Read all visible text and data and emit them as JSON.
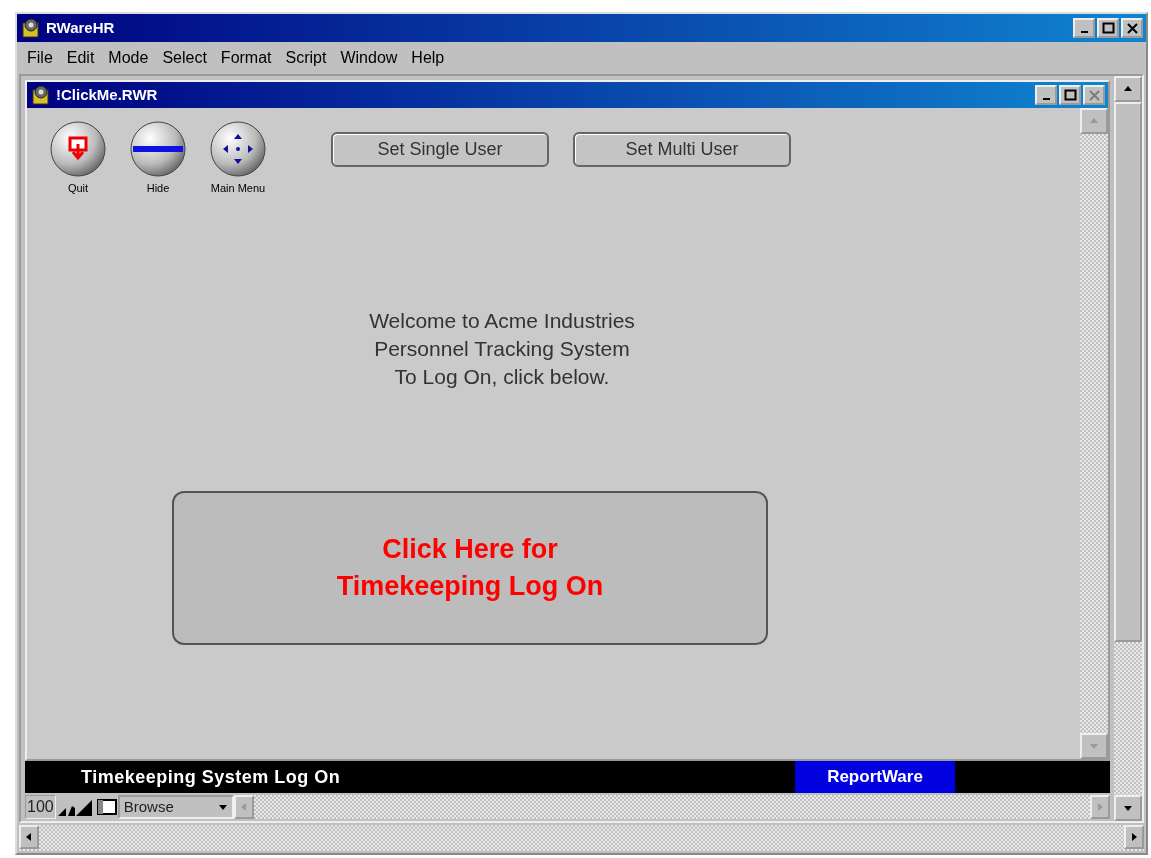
{
  "window": {
    "title": "RWareHR"
  },
  "menu": [
    "File",
    "Edit",
    "Mode",
    "Select",
    "Format",
    "Script",
    "Window",
    "Help"
  ],
  "document": {
    "title": "!ClickMe.RWR",
    "close_disabled": true,
    "icon_buttons": [
      {
        "kind": "quit",
        "label": "Quit"
      },
      {
        "kind": "hide",
        "label": "Hide"
      },
      {
        "kind": "main_menu",
        "label": "Main Menu"
      }
    ],
    "buttons": [
      "Set Single User",
      "Set Multi User"
    ],
    "welcome": [
      "Welcome to Acme Industries",
      "Personnel Tracking System",
      "To Log On, click below."
    ],
    "logon_button": [
      "Click Here for",
      "Timekeeping Log On"
    ],
    "status_bar": {
      "title": "Timekeeping System Log On",
      "brand": "ReportWare"
    },
    "toolbar": {
      "zoom": "100",
      "mode": "Browse"
    }
  }
}
